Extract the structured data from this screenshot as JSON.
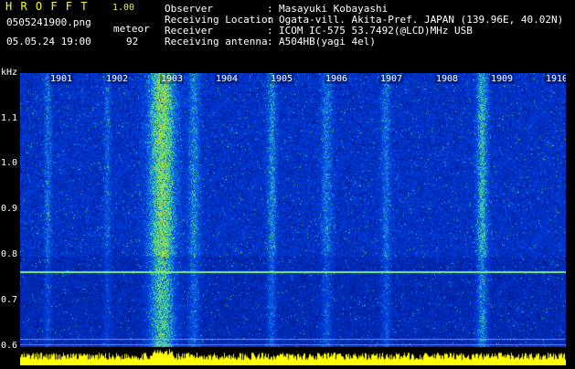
{
  "header": {
    "app_title": "H R O F F T",
    "version": "1.00",
    "filename": "0505241900.png",
    "mode": "meteor",
    "datetime": "05.05.24 19:00",
    "count": "92"
  },
  "station": {
    "rows": [
      {
        "label": "Observer",
        "sep": ":",
        "value": "Masayuki Kobayashi"
      },
      {
        "label": "Receiving Location",
        "sep": ":",
        "value": "Ogata-vill. Akita-Pref. JAPAN (139.96E, 40.02N)"
      },
      {
        "label": "Receiver",
        "sep": ":",
        "value": "ICOM IC-575 53.7492(@LCD)MHz USB"
      },
      {
        "label": "Receiving antenna",
        "sep": ":",
        "value": "A504HB(yagi 4el)"
      }
    ]
  },
  "yaxis": {
    "unit": "kHz",
    "ticks": [
      "1.1",
      "1.0",
      "0.9",
      "0.8",
      "0.7",
      "0.6"
    ]
  },
  "xaxis": {
    "ticks": [
      "1901",
      "1902",
      "1903",
      "1904",
      "1905",
      "1906",
      "1907",
      "1908",
      "1909",
      "1910"
    ]
  },
  "colors": {
    "background": "#000000",
    "header_yellow": "#ffff00",
    "spectrogram_base": "#0a1a9a",
    "carrier_line": "#80f080",
    "amplitude_bars": "#ffff00"
  }
}
